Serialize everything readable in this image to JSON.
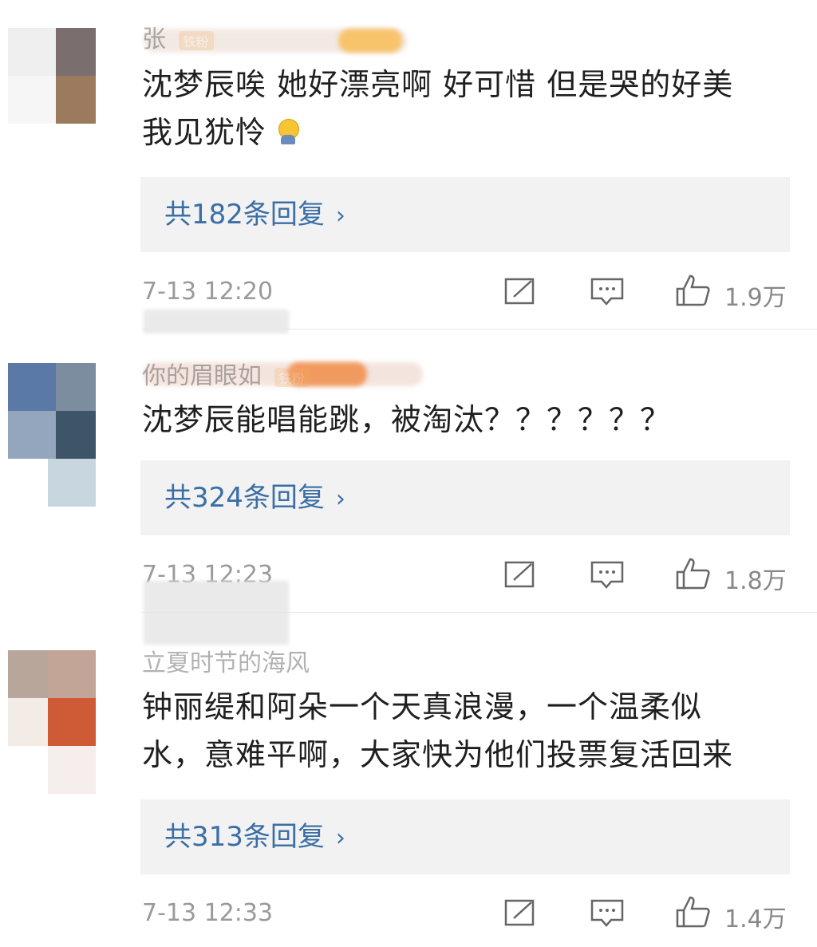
{
  "comments": [
    {
      "username": "张",
      "badge": "铁粉",
      "text_line1": "沈梦辰唉 她好漂亮啊 好可惜 但是哭的好美",
      "text_line2": "我见犹怜",
      "emoji": "yawn-emoji",
      "replies_label": "共182条回复",
      "time": "7-13 12:20",
      "likes": "1.9万"
    },
    {
      "username": "你的眉眼如",
      "badge": "铁粉",
      "text_line1": "沈梦辰能唱能跳，被淘汰？？？？？？",
      "replies_label": "共324条回复",
      "time": "7-13 12:23",
      "likes": "1.8万"
    },
    {
      "username": "立夏时节的海风",
      "text_line1": "钟丽缇和阿朵一个天真浪漫，一个温柔似",
      "text_line2": "水，意难平啊，大家快为他们投票复活回来",
      "replies_label": "共313条回复",
      "time": "7-13 12:33",
      "likes": "1.4万"
    }
  ],
  "icons": {
    "share": "share-icon",
    "comment": "comment-icon",
    "like": "thumbs-up-icon",
    "chevron": "chevron-right-icon"
  },
  "colors": {
    "link": "#3a6ea5",
    "reply_bg": "#f2f2f2",
    "meta": "#9a9a9a"
  }
}
